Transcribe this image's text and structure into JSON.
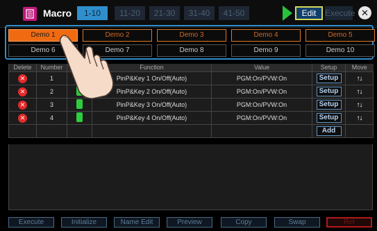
{
  "header": {
    "title": "Macro",
    "range_tabs": [
      "1-10",
      "11-20",
      "21-30",
      "31-40",
      "41-50"
    ],
    "edit_label": "Edit",
    "execute_label": "Execute",
    "close_symbol": "✕"
  },
  "demos": {
    "row1": [
      "Demo 1",
      "Demo 2",
      "Demo 3",
      "Demo 4",
      "Demo 5"
    ],
    "row2": [
      "Demo 6",
      "Demo 7",
      "Demo 8",
      "Demo 9",
      "Demo 10"
    ]
  },
  "table": {
    "headers": [
      "Delete",
      "Number",
      "",
      "Function",
      "Value",
      "Setup",
      "Move"
    ],
    "rows": [
      {
        "number": "1",
        "function": "PinP&Key 1 On/Off(Auto)",
        "value": "PGM:On/PVW:On",
        "setup": "Setup"
      },
      {
        "number": "2",
        "function": "PinP&Key 2 On/Off(Auto)",
        "value": "PGM:On/PVW:On",
        "setup": "Setup"
      },
      {
        "number": "3",
        "function": "PinP&Key 3 On/Off(Auto)",
        "value": "PGM:On/PVW:On",
        "setup": "Setup"
      },
      {
        "number": "4",
        "function": "PinP&Key 4 On/Off(Auto)",
        "value": "PGM:On/PVW:On",
        "setup": "Setup"
      }
    ],
    "add_label": "Add",
    "delete_symbol": "✕",
    "move_symbol": "↑↓"
  },
  "toolbar": {
    "execute": "Execute",
    "initialize": "Initialize",
    "name_edit": "Name Edit",
    "preview": "Preview",
    "copy": "Copy",
    "swap": "Swap",
    "ret": "Ret"
  },
  "colors": {
    "accent": "#2f8fcd",
    "active_demo": "#f06a12",
    "delete": "#e22a2a",
    "toggle": "#2ecc40",
    "play": "#28c33a"
  },
  "icons": [
    "macro-app-icon",
    "play-icon",
    "close-icon",
    "delete-icon",
    "move-icon",
    "hand-pointer-icon"
  ]
}
